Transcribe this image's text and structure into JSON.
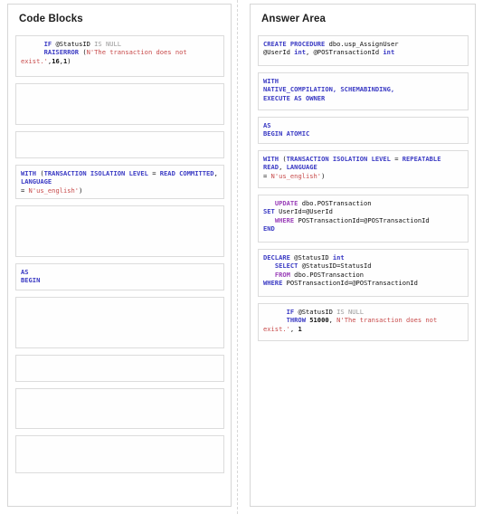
{
  "layout": {
    "divider": "dashed-vertical-divider",
    "background": "#ffffff",
    "panel_border": "#d6d6d6",
    "block_border": "#dcdcdc"
  },
  "colors": {
    "keyword_blue": "#3b3bc4",
    "keyword_purple": "#9a3fb8",
    "string_red": "#c84b4b",
    "comment_gray": "#9a9a9a",
    "text_black": "#111111"
  },
  "left_panel": {
    "title": "Code Blocks",
    "blocks": [
      {
        "id": "cb-1",
        "empty": false,
        "text": "    IF @StatusID IS NULL\n    RAISERROR (N'The transaction does not exist.',16,1)",
        "lines": [
          {
            "segments": [
              {
                "t": "      ",
                "c": "plain"
              },
              {
                "t": "IF",
                "c": "kw"
              },
              {
                "t": " @StatusID ",
                "c": "plain"
              },
              {
                "t": "IS NULL",
                "c": "gray"
              }
            ]
          },
          {
            "segments": [
              {
                "t": "      ",
                "c": "plain"
              },
              {
                "t": "RAISERROR",
                "c": "kw"
              },
              {
                "t": " (",
                "c": "plain"
              },
              {
                "t": "N'The transaction does not exist.'",
                "c": "str"
              },
              {
                "t": ",",
                "c": "plain"
              },
              {
                "t": "16",
                "c": "num"
              },
              {
                "t": ",",
                "c": "plain"
              },
              {
                "t": "1",
                "c": "num"
              },
              {
                "t": ")",
                "c": "plain"
              }
            ]
          }
        ]
      },
      {
        "id": "cb-2",
        "empty": true,
        "text": "",
        "lines": []
      },
      {
        "id": "cb-3",
        "empty": true,
        "text": "",
        "lines": []
      },
      {
        "id": "cb-4",
        "empty": false,
        "text": "WITH (TRANSACTION ISOLATION LEVEL = READ COMMITTED, LANGUAGE\n= N'us_english')",
        "lines": [
          {
            "segments": [
              {
                "t": "WITH",
                "c": "kw"
              },
              {
                "t": " (",
                "c": "plain"
              },
              {
                "t": "TRANSACTION ISOLATION LEVEL",
                "c": "kw"
              },
              {
                "t": " = ",
                "c": "plain"
              },
              {
                "t": "READ COMMITTED",
                "c": "kw"
              },
              {
                "t": ", ",
                "c": "plain"
              },
              {
                "t": "LANGUAGE",
                "c": "kw"
              }
            ]
          },
          {
            "segments": [
              {
                "t": "= ",
                "c": "plain"
              },
              {
                "t": "N'us_english'",
                "c": "str"
              },
              {
                "t": ")",
                "c": "plain"
              }
            ]
          }
        ]
      },
      {
        "id": "cb-5",
        "empty": true,
        "text": "",
        "lines": []
      },
      {
        "id": "cb-6",
        "empty": false,
        "text": "AS\nBEGIN",
        "lines": [
          {
            "segments": [
              {
                "t": "AS",
                "c": "kw"
              }
            ]
          },
          {
            "segments": [
              {
                "t": "BEGIN",
                "c": "kw"
              }
            ]
          }
        ]
      },
      {
        "id": "cb-7",
        "empty": true,
        "text": "",
        "lines": []
      },
      {
        "id": "cb-8",
        "empty": true,
        "text": "",
        "lines": []
      },
      {
        "id": "cb-9",
        "empty": true,
        "text": "",
        "lines": []
      },
      {
        "id": "cb-10",
        "empty": true,
        "text": "",
        "lines": []
      }
    ]
  },
  "right_panel": {
    "title": "Answer Area",
    "blocks": [
      {
        "id": "ab-1",
        "empty": false,
        "text": "CREATE PROCEDURE dbo.usp_AssignUser @UserId int, @POSTransactionId int",
        "lines": [
          {
            "segments": [
              {
                "t": "CREATE PROCEDURE",
                "c": "kw"
              },
              {
                "t": " dbo.usp_AssignUser",
                "c": "plain"
              }
            ]
          },
          {
            "segments": [
              {
                "t": "@UserId ",
                "c": "plain"
              },
              {
                "t": "int",
                "c": "kw"
              },
              {
                "t": ", @POSTransactionId ",
                "c": "plain"
              },
              {
                "t": "int",
                "c": "kw"
              }
            ]
          }
        ]
      },
      {
        "id": "ab-2",
        "empty": false,
        "text": "WITH\nNATIVE_COMPILATION, SCHEMABINDING,\nEXECUTE AS OWNER",
        "lines": [
          {
            "segments": [
              {
                "t": "WITH",
                "c": "kw"
              }
            ]
          },
          {
            "segments": [
              {
                "t": "NATIVE_COMPILATION, SCHEMABINDING,",
                "c": "kw"
              }
            ]
          },
          {
            "segments": [
              {
                "t": "EXECUTE AS OWNER",
                "c": "kw"
              }
            ]
          }
        ]
      },
      {
        "id": "ab-3",
        "empty": false,
        "text": "AS\nBEGIN ATOMIC",
        "lines": [
          {
            "segments": [
              {
                "t": "AS",
                "c": "kw"
              }
            ]
          },
          {
            "segments": [
              {
                "t": "BEGIN ATOMIC",
                "c": "kw"
              }
            ]
          }
        ]
      },
      {
        "id": "ab-4",
        "empty": false,
        "text": "WITH (TRANSACTION ISOLATION LEVEL = REPEATABLE READ, LANGUAGE\n= N'us_english')",
        "lines": [
          {
            "segments": [
              {
                "t": "WITH",
                "c": "kw"
              },
              {
                "t": " (",
                "c": "plain"
              },
              {
                "t": "TRANSACTION ISOLATION LEVEL",
                "c": "kw"
              },
              {
                "t": " = ",
                "c": "plain"
              },
              {
                "t": "REPEATABLE READ",
                "c": "kw"
              },
              {
                "t": ", ",
                "c": "plain"
              },
              {
                "t": "LANGUAGE",
                "c": "kw"
              }
            ]
          },
          {
            "segments": [
              {
                "t": "= ",
                "c": "plain"
              },
              {
                "t": "N'us_english'",
                "c": "str"
              },
              {
                "t": ")",
                "c": "plain"
              }
            ]
          }
        ]
      },
      {
        "id": "ab-5",
        "empty": false,
        "text": "  UPDATE dbo.POSTransaction\nSET UserId=@UserId\n  WHERE POSTransactionId=@POSTransactionId\nEND",
        "lines": [
          {
            "segments": [
              {
                "t": "   ",
                "c": "plain"
              },
              {
                "t": "UPDATE",
                "c": "kw2"
              },
              {
                "t": " dbo.POSTransaction",
                "c": "plain"
              }
            ]
          },
          {
            "segments": [
              {
                "t": "SET",
                "c": "kw"
              },
              {
                "t": " UserId=@UserId",
                "c": "plain"
              }
            ]
          },
          {
            "segments": [
              {
                "t": "   ",
                "c": "plain"
              },
              {
                "t": "WHERE",
                "c": "kw2"
              },
              {
                "t": " POSTransactionId=@POSTransactionId",
                "c": "plain"
              }
            ]
          },
          {
            "segments": [
              {
                "t": "END",
                "c": "kw"
              }
            ]
          }
        ]
      },
      {
        "id": "ab-6",
        "empty": false,
        "text": "DECLARE @StatusID int\n  SELECT @StatusID=StatusId\n  FROM dbo.POSTransaction\nWHERE POSTransactionId=@POSTransactionId",
        "lines": [
          {
            "segments": [
              {
                "t": "DECLARE",
                "c": "kw"
              },
              {
                "t": " @StatusID ",
                "c": "plain"
              },
              {
                "t": "int",
                "c": "kw"
              }
            ]
          },
          {
            "segments": [
              {
                "t": "   ",
                "c": "plain"
              },
              {
                "t": "SELECT",
                "c": "kw"
              },
              {
                "t": " @StatusID=StatusId",
                "c": "plain"
              }
            ]
          },
          {
            "segments": [
              {
                "t": "   ",
                "c": "plain"
              },
              {
                "t": "FROM",
                "c": "kw2"
              },
              {
                "t": " dbo.POSTransaction",
                "c": "plain"
              }
            ]
          },
          {
            "segments": [
              {
                "t": "WHERE",
                "c": "kw"
              },
              {
                "t": " POSTransactionId=@POSTransactionId",
                "c": "plain"
              }
            ]
          }
        ]
      },
      {
        "id": "ab-7",
        "empty": false,
        "text": "    IF @StatusID IS NULL\n    THROW 51000, N'The transaction does not exist.', 1",
        "lines": [
          {
            "segments": [
              {
                "t": "      ",
                "c": "plain"
              },
              {
                "t": "IF",
                "c": "kw"
              },
              {
                "t": " @StatusID ",
                "c": "plain"
              },
              {
                "t": "IS NULL",
                "c": "gray"
              }
            ]
          },
          {
            "segments": [
              {
                "t": "      ",
                "c": "plain"
              },
              {
                "t": "THROW",
                "c": "kw"
              },
              {
                "t": " ",
                "c": "plain"
              },
              {
                "t": "51000",
                "c": "num"
              },
              {
                "t": ", ",
                "c": "plain"
              },
              {
                "t": "N'The transaction does not exist.'",
                "c": "str"
              },
              {
                "t": ", ",
                "c": "plain"
              },
              {
                "t": "1",
                "c": "num"
              }
            ]
          }
        ]
      }
    ]
  }
}
